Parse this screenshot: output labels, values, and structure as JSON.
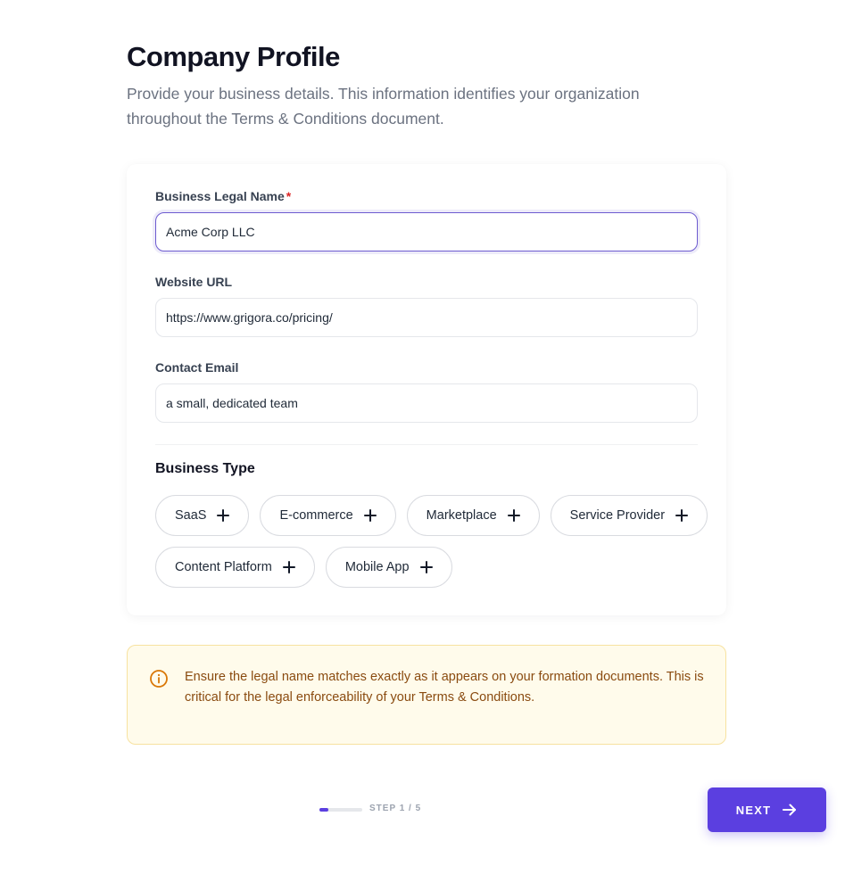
{
  "header": {
    "title": "Company Profile",
    "subtitle": "Provide your business details. This information identifies your organization throughout the Terms & Conditions document."
  },
  "form": {
    "legal_name": {
      "label": "Business Legal Name",
      "required_mark": "*",
      "value": "Acme Corp LLC"
    },
    "website": {
      "label": "Website URL",
      "value": "https://www.grigora.co/pricing/"
    },
    "email": {
      "label": "Contact Email",
      "value": "a small, dedicated team"
    },
    "business_type": {
      "title": "Business Type",
      "options": [
        "SaaS",
        "E-commerce",
        "Marketplace",
        "Service Provider",
        "Content Platform",
        "Mobile App"
      ]
    }
  },
  "notice": {
    "text": "Ensure the legal name matches exactly as it appears on your formation documents. This is critical for the legal enforceability of your Terms & Conditions.",
    "icon": "info-icon"
  },
  "footer": {
    "step_label": "STEP 1 / 5",
    "progress_fraction": 0.2,
    "next_label": "NEXT"
  },
  "colors": {
    "accent": "#5b3fe0",
    "focus_border": "#6d5bd0",
    "required": "#dc2626",
    "notice_bg": "#fffbeb",
    "notice_text": "#8a4b10"
  }
}
